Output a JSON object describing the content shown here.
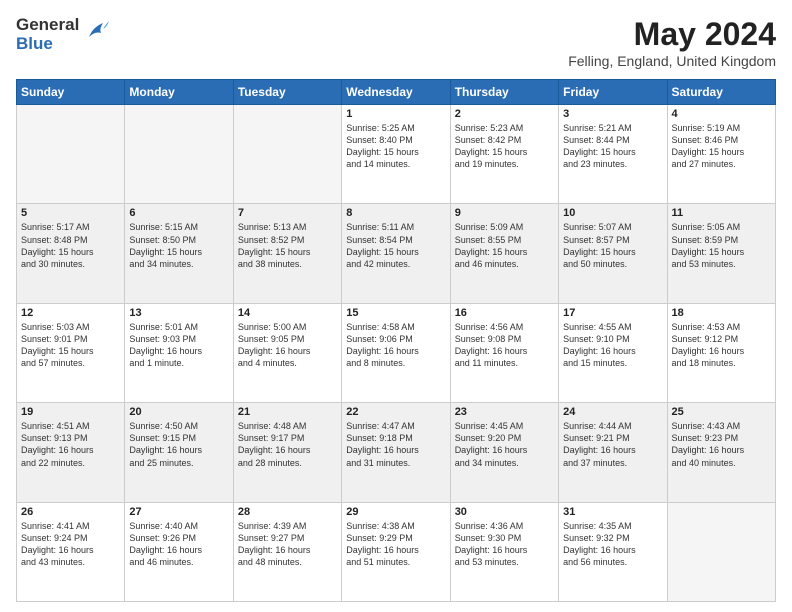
{
  "header": {
    "logo_general": "General",
    "logo_blue": "Blue",
    "month_title": "May 2024",
    "location": "Felling, England, United Kingdom"
  },
  "days_of_week": [
    "Sunday",
    "Monday",
    "Tuesday",
    "Wednesday",
    "Thursday",
    "Friday",
    "Saturday"
  ],
  "weeks": [
    [
      {
        "day": "",
        "info": ""
      },
      {
        "day": "",
        "info": ""
      },
      {
        "day": "",
        "info": ""
      },
      {
        "day": "1",
        "info": "Sunrise: 5:25 AM\nSunset: 8:40 PM\nDaylight: 15 hours\nand 14 minutes."
      },
      {
        "day": "2",
        "info": "Sunrise: 5:23 AM\nSunset: 8:42 PM\nDaylight: 15 hours\nand 19 minutes."
      },
      {
        "day": "3",
        "info": "Sunrise: 5:21 AM\nSunset: 8:44 PM\nDaylight: 15 hours\nand 23 minutes."
      },
      {
        "day": "4",
        "info": "Sunrise: 5:19 AM\nSunset: 8:46 PM\nDaylight: 15 hours\nand 27 minutes."
      }
    ],
    [
      {
        "day": "5",
        "info": "Sunrise: 5:17 AM\nSunset: 8:48 PM\nDaylight: 15 hours\nand 30 minutes."
      },
      {
        "day": "6",
        "info": "Sunrise: 5:15 AM\nSunset: 8:50 PM\nDaylight: 15 hours\nand 34 minutes."
      },
      {
        "day": "7",
        "info": "Sunrise: 5:13 AM\nSunset: 8:52 PM\nDaylight: 15 hours\nand 38 minutes."
      },
      {
        "day": "8",
        "info": "Sunrise: 5:11 AM\nSunset: 8:54 PM\nDaylight: 15 hours\nand 42 minutes."
      },
      {
        "day": "9",
        "info": "Sunrise: 5:09 AM\nSunset: 8:55 PM\nDaylight: 15 hours\nand 46 minutes."
      },
      {
        "day": "10",
        "info": "Sunrise: 5:07 AM\nSunset: 8:57 PM\nDaylight: 15 hours\nand 50 minutes."
      },
      {
        "day": "11",
        "info": "Sunrise: 5:05 AM\nSunset: 8:59 PM\nDaylight: 15 hours\nand 53 minutes."
      }
    ],
    [
      {
        "day": "12",
        "info": "Sunrise: 5:03 AM\nSunset: 9:01 PM\nDaylight: 15 hours\nand 57 minutes."
      },
      {
        "day": "13",
        "info": "Sunrise: 5:01 AM\nSunset: 9:03 PM\nDaylight: 16 hours\nand 1 minute."
      },
      {
        "day": "14",
        "info": "Sunrise: 5:00 AM\nSunset: 9:05 PM\nDaylight: 16 hours\nand 4 minutes."
      },
      {
        "day": "15",
        "info": "Sunrise: 4:58 AM\nSunset: 9:06 PM\nDaylight: 16 hours\nand 8 minutes."
      },
      {
        "day": "16",
        "info": "Sunrise: 4:56 AM\nSunset: 9:08 PM\nDaylight: 16 hours\nand 11 minutes."
      },
      {
        "day": "17",
        "info": "Sunrise: 4:55 AM\nSunset: 9:10 PM\nDaylight: 16 hours\nand 15 minutes."
      },
      {
        "day": "18",
        "info": "Sunrise: 4:53 AM\nSunset: 9:12 PM\nDaylight: 16 hours\nand 18 minutes."
      }
    ],
    [
      {
        "day": "19",
        "info": "Sunrise: 4:51 AM\nSunset: 9:13 PM\nDaylight: 16 hours\nand 22 minutes."
      },
      {
        "day": "20",
        "info": "Sunrise: 4:50 AM\nSunset: 9:15 PM\nDaylight: 16 hours\nand 25 minutes."
      },
      {
        "day": "21",
        "info": "Sunrise: 4:48 AM\nSunset: 9:17 PM\nDaylight: 16 hours\nand 28 minutes."
      },
      {
        "day": "22",
        "info": "Sunrise: 4:47 AM\nSunset: 9:18 PM\nDaylight: 16 hours\nand 31 minutes."
      },
      {
        "day": "23",
        "info": "Sunrise: 4:45 AM\nSunset: 9:20 PM\nDaylight: 16 hours\nand 34 minutes."
      },
      {
        "day": "24",
        "info": "Sunrise: 4:44 AM\nSunset: 9:21 PM\nDaylight: 16 hours\nand 37 minutes."
      },
      {
        "day": "25",
        "info": "Sunrise: 4:43 AM\nSunset: 9:23 PM\nDaylight: 16 hours\nand 40 minutes."
      }
    ],
    [
      {
        "day": "26",
        "info": "Sunrise: 4:41 AM\nSunset: 9:24 PM\nDaylight: 16 hours\nand 43 minutes."
      },
      {
        "day": "27",
        "info": "Sunrise: 4:40 AM\nSunset: 9:26 PM\nDaylight: 16 hours\nand 46 minutes."
      },
      {
        "day": "28",
        "info": "Sunrise: 4:39 AM\nSunset: 9:27 PM\nDaylight: 16 hours\nand 48 minutes."
      },
      {
        "day": "29",
        "info": "Sunrise: 4:38 AM\nSunset: 9:29 PM\nDaylight: 16 hours\nand 51 minutes."
      },
      {
        "day": "30",
        "info": "Sunrise: 4:36 AM\nSunset: 9:30 PM\nDaylight: 16 hours\nand 53 minutes."
      },
      {
        "day": "31",
        "info": "Sunrise: 4:35 AM\nSunset: 9:32 PM\nDaylight: 16 hours\nand 56 minutes."
      },
      {
        "day": "",
        "info": ""
      }
    ]
  ]
}
